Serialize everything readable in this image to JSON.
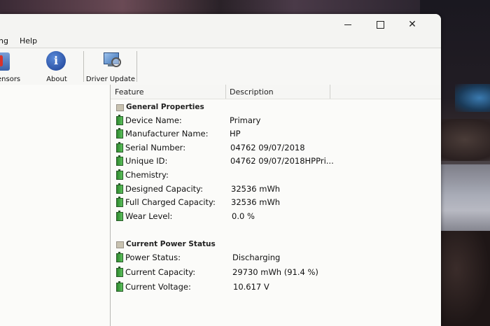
{
  "window": {
    "controls": {
      "minimize": "–",
      "maximize": "□",
      "close": "✕"
    }
  },
  "menu": {
    "items": [
      "ng",
      "Help"
    ]
  },
  "toolbar": {
    "buttons": [
      {
        "label": "ensors",
        "icon": "thermometer-icon"
      },
      {
        "label": "About",
        "icon": "info-icon"
      },
      {
        "label": "Driver Update",
        "icon": "monitor-magnifier-icon"
      }
    ]
  },
  "table": {
    "headers": {
      "feature": "Feature",
      "description": "Description"
    },
    "sections": [
      {
        "title": "General Properties",
        "rows": [
          {
            "feature": "Device Name:",
            "value": "Primary"
          },
          {
            "feature": "Manufacturer Name:",
            "value": "HP"
          },
          {
            "feature": "Serial Number:",
            "value": "04762 09/07/2018"
          },
          {
            "feature": "Unique ID:",
            "value": "04762 09/07/2018HPPri..."
          },
          {
            "feature": "Chemistry:",
            "value": ""
          },
          {
            "feature": "Designed Capacity:",
            "value": "32536 mWh"
          },
          {
            "feature": "Full Charged Capacity:",
            "value": "32536 mWh"
          },
          {
            "feature": "Wear Level:",
            "value": "0.0 %"
          }
        ]
      },
      {
        "title": "Current Power Status",
        "rows": [
          {
            "feature": "Power Status:",
            "value": "Discharging"
          },
          {
            "feature": "Current Capacity:",
            "value": "29730 mWh (91.4 %)"
          },
          {
            "feature": "Current Voltage:",
            "value": "10.617 V"
          }
        ]
      }
    ]
  },
  "colors": {
    "row_icon": "#3aa03a",
    "window_bg": "#f3f3f0"
  }
}
